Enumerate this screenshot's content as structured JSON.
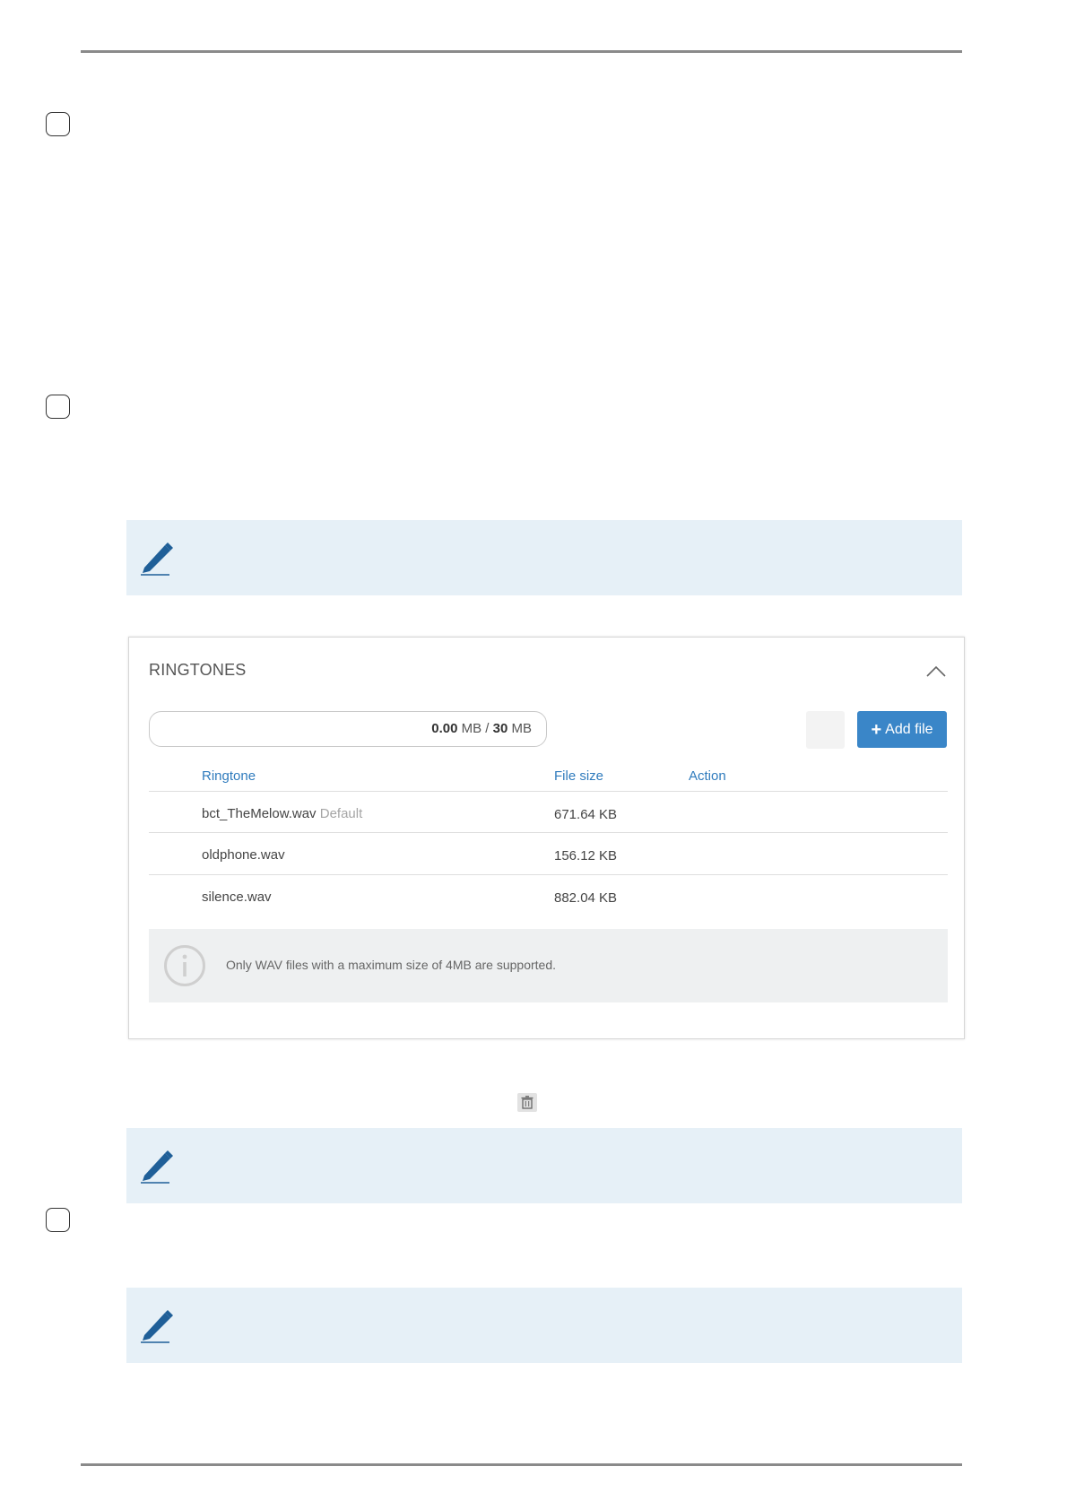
{
  "panel": {
    "title": "RINGTONES",
    "storage": {
      "used": "0.00",
      "used_unit": "MB",
      "separator": "/",
      "total": "30",
      "total_unit": "MB"
    },
    "add_button": {
      "icon": "plus-icon",
      "label": "Add file"
    },
    "columns": [
      "Ringtone",
      "File size",
      "Action"
    ],
    "rows": [
      {
        "name": "bct_TheMelow.wav",
        "tag": "Default",
        "size": "671.64 KB"
      },
      {
        "name": "oldphone.wav",
        "tag": "",
        "size": "156.12 KB"
      },
      {
        "name": "silence.wav",
        "tag": "",
        "size": "882.04 KB"
      }
    ],
    "info_text": "Only WAV files with a maximum size of 4MB are supported."
  },
  "colors": {
    "accent": "#3a86c8",
    "note_background": "#e6f0f7",
    "pen_icon": "#1f5f98"
  },
  "icons": {
    "note": "pen-icon",
    "collapse": "chevron-up-icon",
    "info": "info-icon",
    "delete": "trash-icon"
  }
}
